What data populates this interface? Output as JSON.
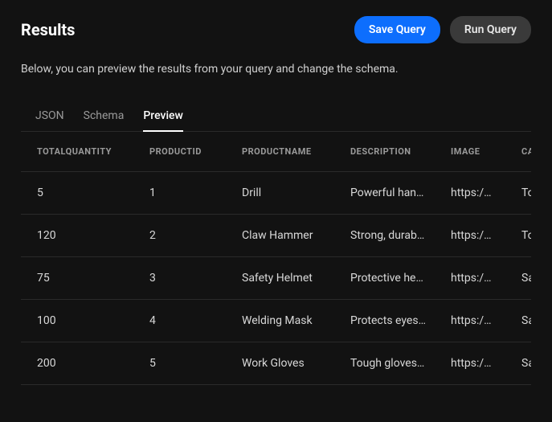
{
  "header": {
    "title": "Results",
    "save_label": "Save Query",
    "run_label": "Run Query"
  },
  "description": "Below, you can preview the results from your query and change the schema.",
  "tabs": {
    "json": "JSON",
    "schema": "Schema",
    "preview": "Preview"
  },
  "table": {
    "columns": {
      "totalquantity": "TOTALQUANTITY",
      "productid": "PRODUCTID",
      "productname": "PRODUCTNAME",
      "description": "DESCRIPTION",
      "image": "IMAGE",
      "category": "CATEGORY"
    },
    "rows": [
      {
        "totalquantity": "5",
        "productid": "1",
        "productname": "Drill",
        "description": "Powerful han…",
        "image": "https:/…",
        "category": "Tools"
      },
      {
        "totalquantity": "120",
        "productid": "2",
        "productname": "Claw Hammer",
        "description": "Strong, durab…",
        "image": "https:/…",
        "category": "Tools"
      },
      {
        "totalquantity": "75",
        "productid": "3",
        "productname": "Safety Helmet",
        "description": "Protective he…",
        "image": "https:/…",
        "category": "Safety"
      },
      {
        "totalquantity": "100",
        "productid": "4",
        "productname": "Welding Mask",
        "description": "Protects eyes …",
        "image": "https:/…",
        "category": "Safety"
      },
      {
        "totalquantity": "200",
        "productid": "5",
        "productname": "Work Gloves",
        "description": "Tough gloves …",
        "image": "https:/…",
        "category": "Safety"
      }
    ]
  }
}
